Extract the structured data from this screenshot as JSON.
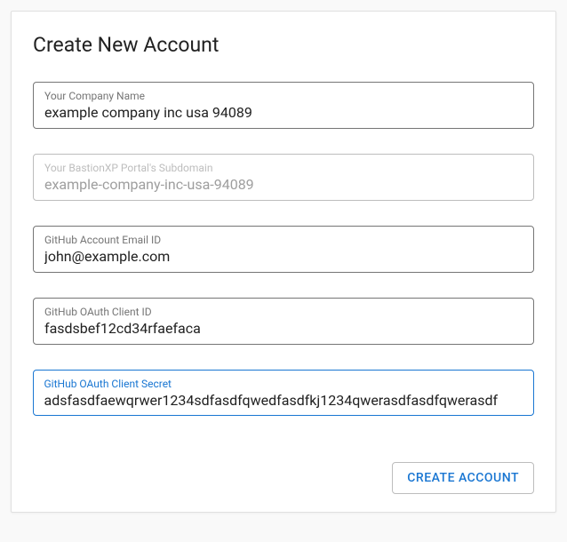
{
  "title": "Create New Account",
  "fields": {
    "company": {
      "label": "Your Company Name",
      "value": "example company inc usa 94089"
    },
    "subdomain": {
      "label": "Your BastionXP Portal's Subdomain",
      "value": "example-company-inc-usa-94089"
    },
    "email": {
      "label": "GitHub Account Email ID",
      "value": "john@example.com"
    },
    "clientId": {
      "label": "GitHub OAuth Client ID",
      "value": "fasdsbef12cd34rfaefaca"
    },
    "clientSecret": {
      "label": "GitHub OAuth Client Secret",
      "value": "adsfasdfaewqrwer1234sdfasdfqwedfasdfkj1234qwerasdfasdfqwerasdf"
    }
  },
  "actions": {
    "submit": "CREATE ACCOUNT"
  }
}
